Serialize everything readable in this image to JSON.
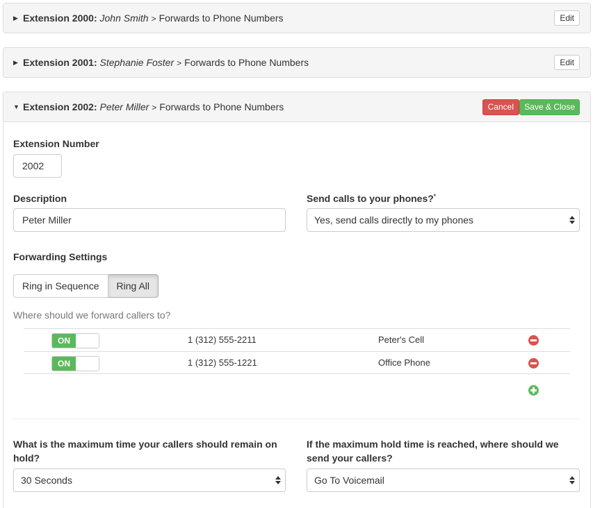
{
  "panels": [
    {
      "extension_label": "Extension 2000:",
      "name": "John Smith",
      "chevron": ">",
      "destination": "Forwards to Phone Numbers",
      "edit_label": "Edit"
    },
    {
      "extension_label": "Extension 2001:",
      "name": "Stephanie Foster",
      "chevron": ">",
      "destination": "Forwards to Phone Numbers",
      "edit_label": "Edit"
    },
    {
      "extension_label": "Extension 2002:",
      "name": "Peter Miller",
      "chevron": ">",
      "destination": "Forwards to Phone Numbers",
      "cancel_label": "Cancel",
      "save_label": "Save & Close"
    }
  ],
  "form": {
    "extension_number": {
      "label": "Extension Number",
      "value": "2002"
    },
    "description": {
      "label": "Description",
      "value": "Peter Miller"
    },
    "send_calls": {
      "label": "Send calls to your phones?",
      "required_mark": "*",
      "value": "Yes, send calls directly to my phones"
    },
    "forwarding": {
      "label": "Forwarding Settings",
      "modes": [
        "Ring in Sequence",
        "Ring All"
      ],
      "selected_mode": "Ring All",
      "helper": "Where should we forward callers to?",
      "rows": [
        {
          "toggle": "ON",
          "number": "1 (312) 555-2211",
          "name": "Peter's Cell"
        },
        {
          "toggle": "ON",
          "number": "1 (312) 555-1221",
          "name": "Office Phone"
        }
      ]
    },
    "max_hold": {
      "label": "What is the maximum time your callers should remain on hold?",
      "value": "30 Seconds"
    },
    "hold_reached": {
      "label": "If the maximum hold time is reached, where should we send your callers?",
      "value": "Go To Voicemail"
    }
  },
  "icons": {
    "collapsed_caret": "caret-right-icon",
    "expanded_caret": "caret-down-icon",
    "remove": "remove-circle-icon",
    "add": "add-circle-icon"
  },
  "colors": {
    "danger": "#d9534f",
    "success": "#5cb85c",
    "panel_heading": "#f5f5f5"
  }
}
